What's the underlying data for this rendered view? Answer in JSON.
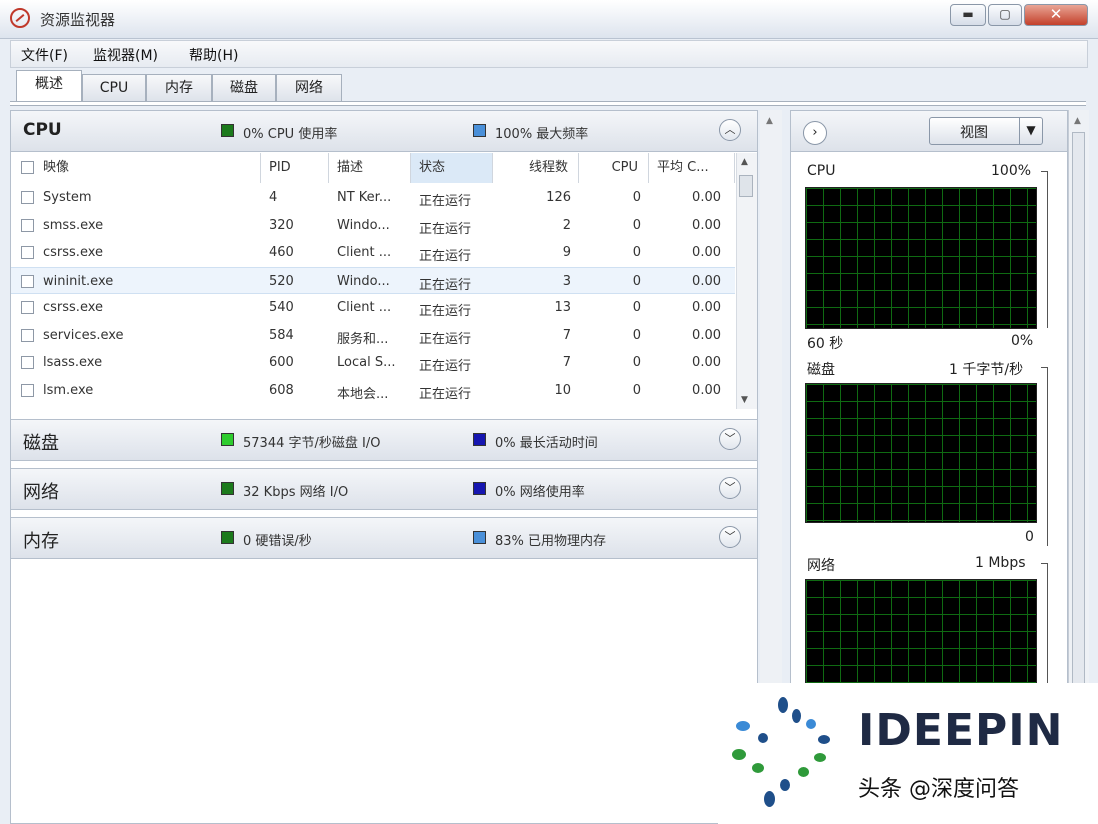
{
  "window": {
    "title": "资源监视器",
    "min_label": "▬",
    "max_label": "▢",
    "close_label": "✕"
  },
  "menu": [
    "文件(F)",
    "监视器(M)",
    "帮助(H)"
  ],
  "tabs": [
    "概述",
    "CPU",
    "内存",
    "磁盘",
    "网络"
  ],
  "active_tab": "概述",
  "cpu_section": {
    "title": "CPU",
    "legend1_color": "#1c7a1c",
    "legend1": "0% CPU 使用率",
    "legend2_color": "#4a90d9",
    "legend2": "100% 最大频率",
    "chevron": "︿",
    "columns": [
      "映像",
      "PID",
      "描述",
      "状态",
      "线程数",
      "CPU",
      "平均 C..."
    ],
    "rows": [
      {
        "image": "System",
        "pid": "4",
        "desc": "NT Ker...",
        "status": "正在运行",
        "threads": "126",
        "cpu": "0",
        "avg": "0.00"
      },
      {
        "image": "smss.exe",
        "pid": "320",
        "desc": "Windo...",
        "status": "正在运行",
        "threads": "2",
        "cpu": "0",
        "avg": "0.00"
      },
      {
        "image": "csrss.exe",
        "pid": "460",
        "desc": "Client ...",
        "status": "正在运行",
        "threads": "9",
        "cpu": "0",
        "avg": "0.00"
      },
      {
        "image": "wininit.exe",
        "pid": "520",
        "desc": "Windo...",
        "status": "正在运行",
        "threads": "3",
        "cpu": "0",
        "avg": "0.00"
      },
      {
        "image": "csrss.exe",
        "pid": "540",
        "desc": "Client ...",
        "status": "正在运行",
        "threads": "13",
        "cpu": "0",
        "avg": "0.00"
      },
      {
        "image": "services.exe",
        "pid": "584",
        "desc": "服务和...",
        "status": "正在运行",
        "threads": "7",
        "cpu": "0",
        "avg": "0.00"
      },
      {
        "image": "lsass.exe",
        "pid": "600",
        "desc": "Local S...",
        "status": "正在运行",
        "threads": "7",
        "cpu": "0",
        "avg": "0.00"
      },
      {
        "image": "lsm.exe",
        "pid": "608",
        "desc": "本地会...",
        "status": "正在运行",
        "threads": "10",
        "cpu": "0",
        "avg": "0.00"
      }
    ]
  },
  "disk_section": {
    "title": "磁盘",
    "legend1_color": "#2ecc2e",
    "legend1": "57344 字节/秒磁盘 I/O",
    "legend2_color": "#1616b0",
    "legend2": "0% 最长活动时间",
    "chevron": "﹀"
  },
  "network_section": {
    "title": "网络",
    "legend1_color": "#1c7a1c",
    "legend1": "32 Kbps 网络 I/O",
    "legend2_color": "#1616b0",
    "legend2": "0% 网络使用率",
    "chevron": "﹀"
  },
  "memory_section": {
    "title": "内存",
    "legend1_color": "#1c7a1c",
    "legend1": "0 硬错误/秒",
    "legend2_color": "#4a90d9",
    "legend2": "83% 已用物理内存",
    "chevron": "﹀"
  },
  "right_panel": {
    "expand_label": "›",
    "view_label": "视图",
    "view_arrow": "▼",
    "cpu_graph": {
      "name": "CPU",
      "max": "100%",
      "time": "60 秒",
      "min": "0%"
    },
    "disk_graph": {
      "name": "磁盘",
      "max": "1 千字节/秒",
      "min": "0"
    },
    "net_graph": {
      "name": "网络",
      "max": "1 Mbps"
    }
  },
  "watermark": {
    "brand": "IDEEPIN",
    "sub": "头条 @深度问答"
  }
}
